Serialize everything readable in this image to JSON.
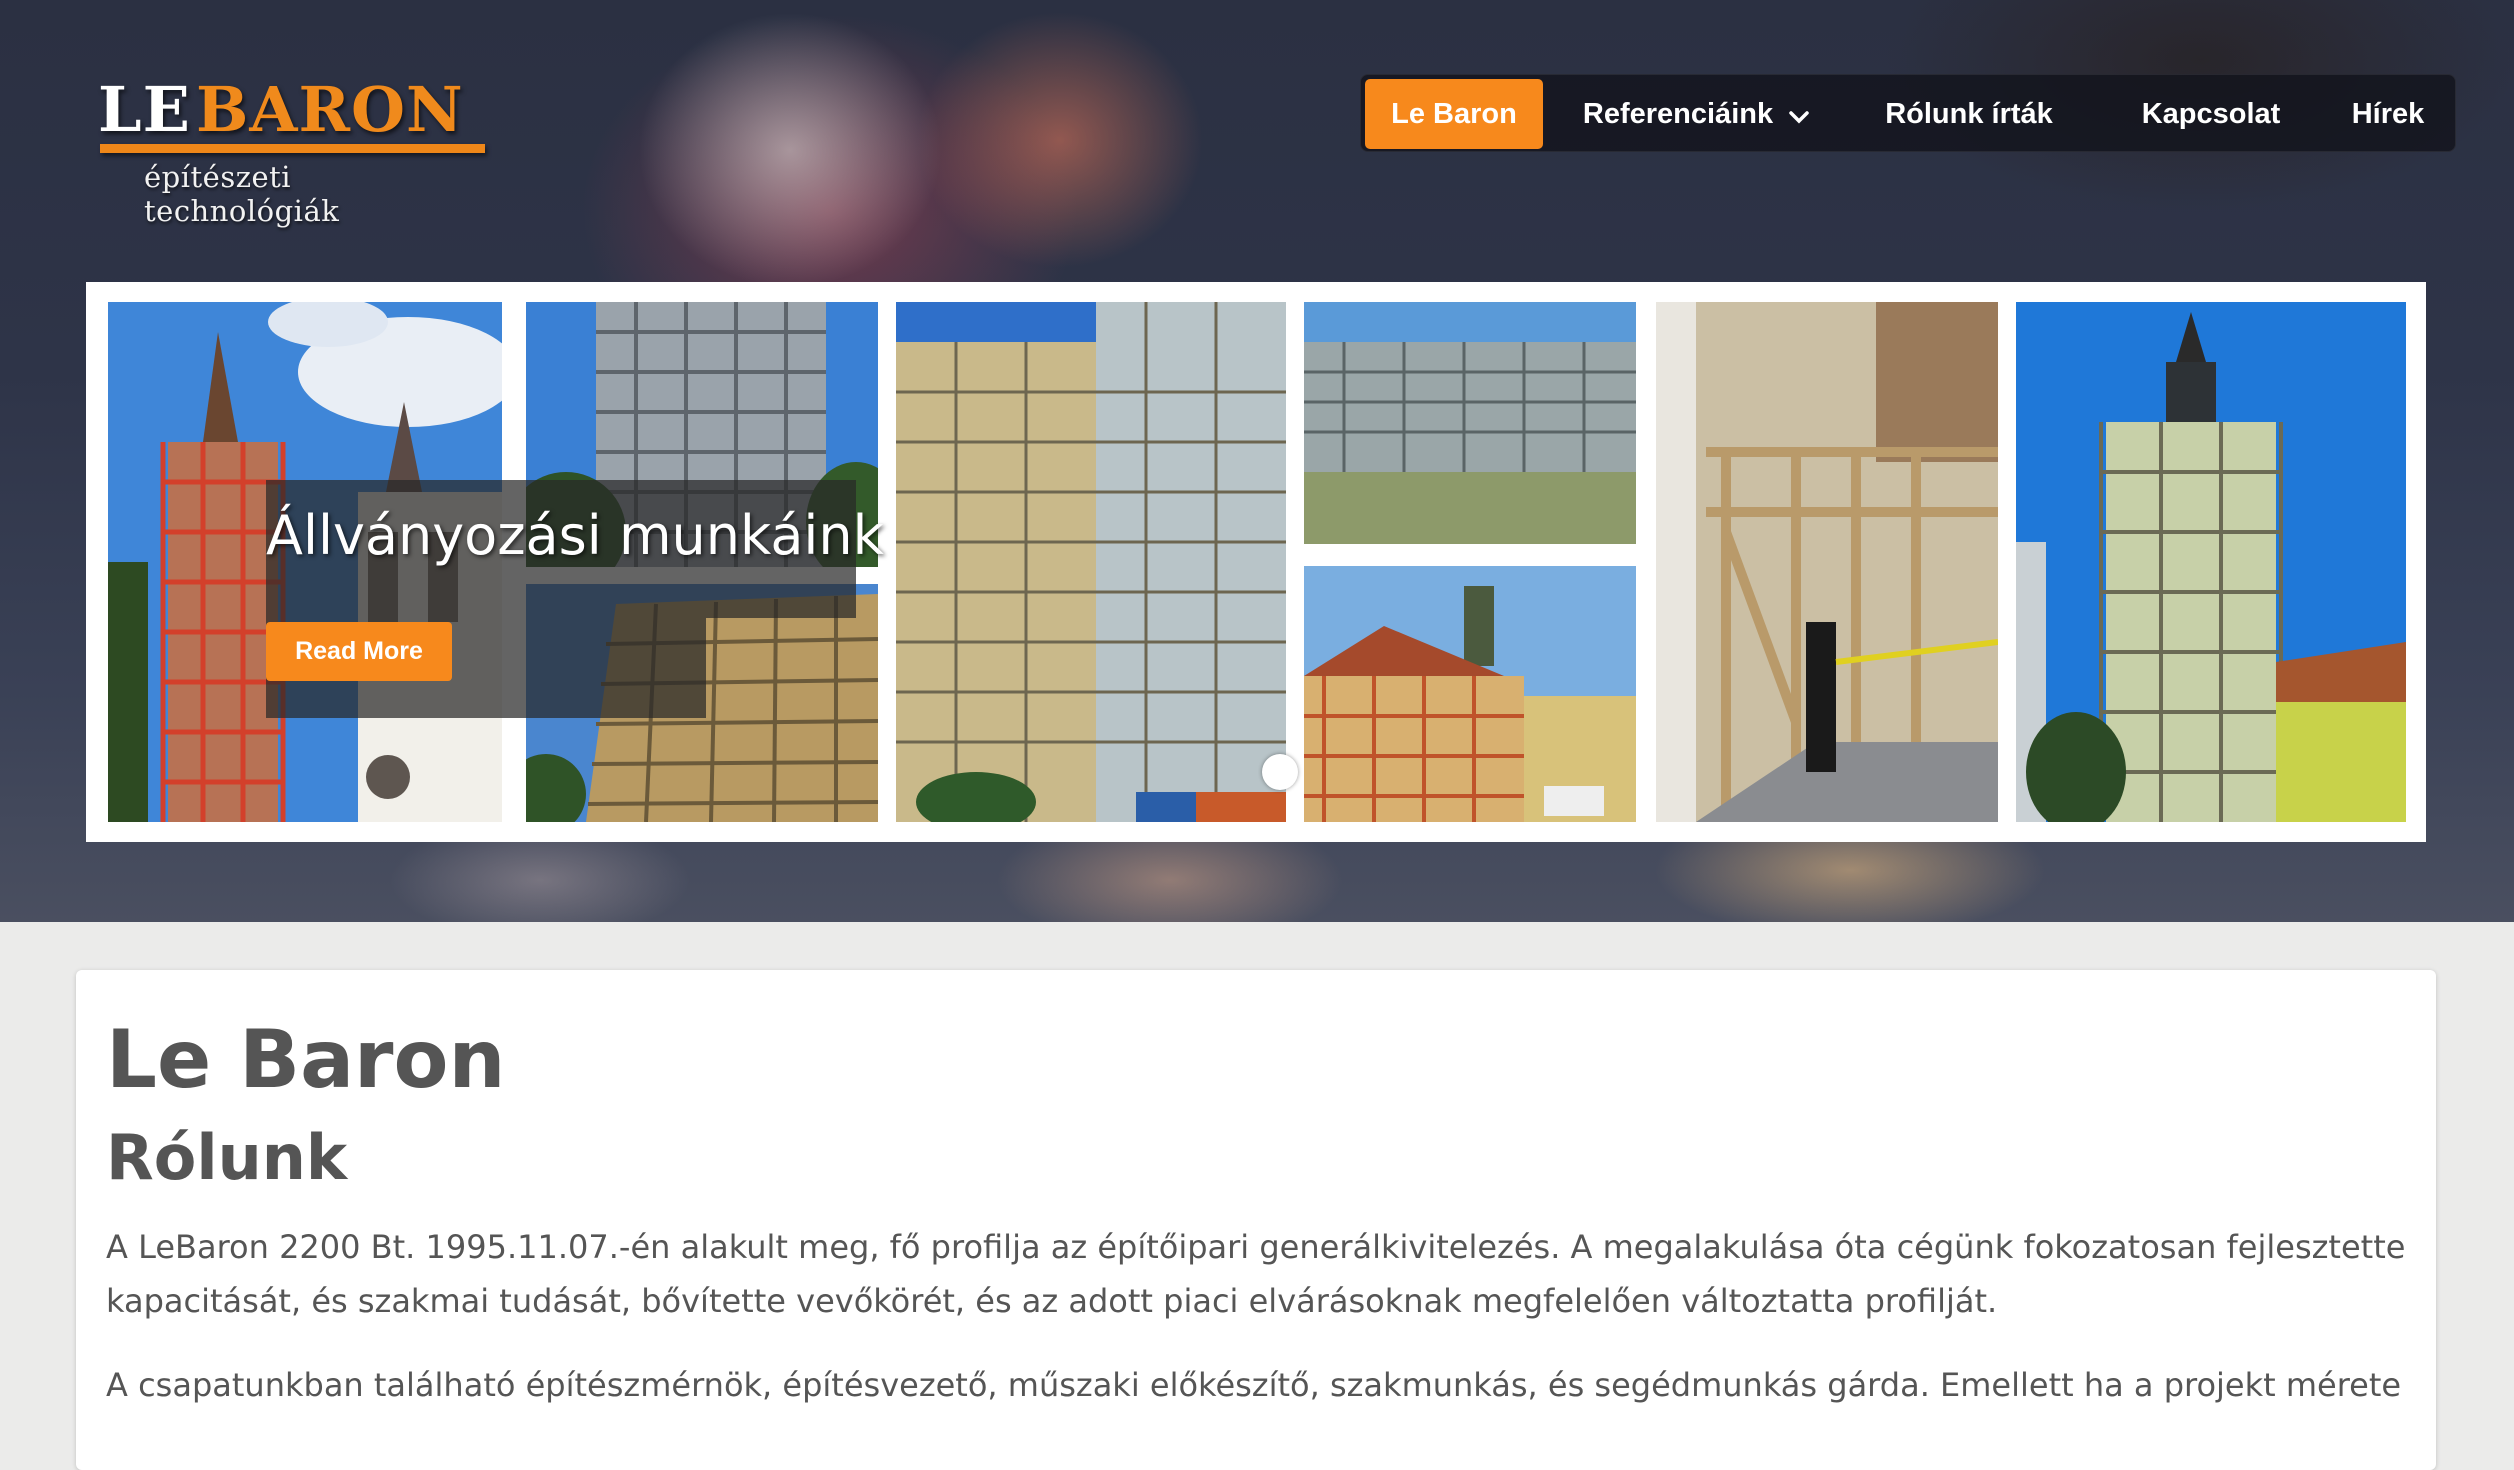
{
  "logo": {
    "word1": "LE",
    "word2": "BARON",
    "tagline": "építészeti technológiák"
  },
  "nav": {
    "items": [
      {
        "label": "Le Baron",
        "active": true
      },
      {
        "label": "Referenciáink",
        "has_dropdown": true
      },
      {
        "label": "Rólunk írták"
      },
      {
        "label": "Kapcsolat"
      },
      {
        "label": "Hírek"
      }
    ]
  },
  "slider": {
    "caption": "Állványozási munkáink",
    "button_label": "Read More"
  },
  "content": {
    "title": "Le Baron",
    "subtitle": "Rólunk",
    "paragraphs": [
      "A LeBaron 2200 Bt. 1995.11.07.-én alakult meg, fő profilja az építőipari generálkivitelezés. A megalakulása óta cégünk fokozatosan fejlesztette kapacitását, és szakmai tudását, bővítette vevőkörét, és az adott piaci elvárásoknak megfelelően változtatta profilját.",
      "A csapatunkban található építészmérnök, építésvezető, műszaki előkészítő, szakmunkás, és segédmunkás gárda. Emellett ha a projekt mérete"
    ]
  },
  "colors": {
    "accent": "#f7891c",
    "text": "#555555",
    "nav_bg": "#15171f"
  }
}
